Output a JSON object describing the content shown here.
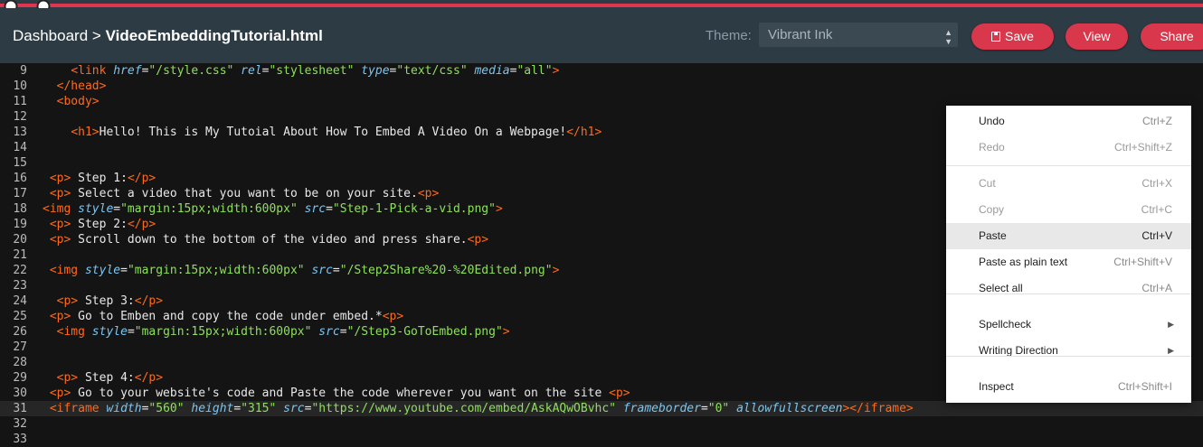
{
  "header": {
    "breadcrumb_root": "Dashboard",
    "breadcrumb_sep": ">",
    "file_name": "VideoEmbeddingTutorial.html",
    "theme_label": "Theme:",
    "theme_value": "Vibrant Ink",
    "save_label": "Save",
    "view_label": "View",
    "share_label": "Share"
  },
  "editor": {
    "lines": [
      {
        "n": "9",
        "tokens": [
          [
            "x",
            "    "
          ],
          [
            "t",
            "<link "
          ],
          [
            "a",
            "href"
          ],
          [
            "x",
            "="
          ],
          [
            "s",
            "\"/style.css\""
          ],
          [
            "x",
            " "
          ],
          [
            "a",
            "rel"
          ],
          [
            "x",
            "="
          ],
          [
            "s",
            "\"stylesheet\""
          ],
          [
            "x",
            " "
          ],
          [
            "a",
            "type"
          ],
          [
            "x",
            "="
          ],
          [
            "s",
            "\"text/css\""
          ],
          [
            "x",
            " "
          ],
          [
            "a",
            "media"
          ],
          [
            "x",
            "="
          ],
          [
            "s",
            "\"all\""
          ],
          [
            "t",
            ">"
          ]
        ]
      },
      {
        "n": "10",
        "tokens": [
          [
            "x",
            "  "
          ],
          [
            "t",
            "</head>"
          ]
        ]
      },
      {
        "n": "11",
        "tokens": [
          [
            "x",
            "  "
          ],
          [
            "t",
            "<body>"
          ]
        ]
      },
      {
        "n": "12",
        "tokens": []
      },
      {
        "n": "13",
        "tokens": [
          [
            "x",
            "    "
          ],
          [
            "t",
            "<h1>"
          ],
          [
            "x",
            "Hello! This is My Tutoial About How To Embed A Video On a Webpage!"
          ],
          [
            "t",
            "</h1>"
          ]
        ]
      },
      {
        "n": "14",
        "tokens": []
      },
      {
        "n": "15",
        "tokens": []
      },
      {
        "n": "16",
        "tokens": [
          [
            "x",
            " "
          ],
          [
            "t",
            "<p>"
          ],
          [
            "x",
            " Step 1:"
          ],
          [
            "t",
            "</p>"
          ]
        ]
      },
      {
        "n": "17",
        "tokens": [
          [
            "x",
            " "
          ],
          [
            "t",
            "<p>"
          ],
          [
            "x",
            " Select a video that you want to be on your site."
          ],
          [
            "t",
            "<p>"
          ]
        ]
      },
      {
        "n": "18",
        "tokens": [
          [
            "t",
            "<img "
          ],
          [
            "a",
            "style"
          ],
          [
            "x",
            "="
          ],
          [
            "s",
            "\"margin:15px;width:600px\""
          ],
          [
            "x",
            " "
          ],
          [
            "a",
            "src"
          ],
          [
            "x",
            "="
          ],
          [
            "s",
            "\"Step-1-Pick-a-vid.png\""
          ],
          [
            "t",
            ">"
          ]
        ]
      },
      {
        "n": "19",
        "tokens": [
          [
            "x",
            " "
          ],
          [
            "t",
            "<p>"
          ],
          [
            "x",
            " Step 2:"
          ],
          [
            "t",
            "</p>"
          ]
        ]
      },
      {
        "n": "20",
        "tokens": [
          [
            "x",
            " "
          ],
          [
            "t",
            "<p>"
          ],
          [
            "x",
            " Scroll down to the bottom of the video and press share."
          ],
          [
            "t",
            "<p>"
          ]
        ]
      },
      {
        "n": "21",
        "tokens": []
      },
      {
        "n": "22",
        "tokens": [
          [
            "x",
            " "
          ],
          [
            "t",
            "<img "
          ],
          [
            "a",
            "style"
          ],
          [
            "x",
            "="
          ],
          [
            "s",
            "\"margin:15px;width:600px\""
          ],
          [
            "x",
            " "
          ],
          [
            "a",
            "src"
          ],
          [
            "x",
            "="
          ],
          [
            "s",
            "\"/Step2Share%20-%20Edited.png\""
          ],
          [
            "t",
            ">"
          ]
        ]
      },
      {
        "n": "23",
        "tokens": []
      },
      {
        "n": "24",
        "tokens": [
          [
            "x",
            "  "
          ],
          [
            "t",
            "<p>"
          ],
          [
            "x",
            " Step 3:"
          ],
          [
            "t",
            "</p>"
          ]
        ]
      },
      {
        "n": "25",
        "tokens": [
          [
            "x",
            " "
          ],
          [
            "t",
            "<p>"
          ],
          [
            "x",
            " Go to Emben and copy the code under embed.*"
          ],
          [
            "t",
            "<p>"
          ]
        ]
      },
      {
        "n": "26",
        "tokens": [
          [
            "x",
            "  "
          ],
          [
            "t",
            "<img "
          ],
          [
            "a",
            "style"
          ],
          [
            "x",
            "="
          ],
          [
            "s",
            "\"margin:15px;width:600px\""
          ],
          [
            "x",
            " "
          ],
          [
            "a",
            "src"
          ],
          [
            "x",
            "="
          ],
          [
            "s",
            "\"/Step3-GoToEmbed.png\""
          ],
          [
            "t",
            ">"
          ]
        ]
      },
      {
        "n": "27",
        "tokens": []
      },
      {
        "n": "28",
        "tokens": []
      },
      {
        "n": "29",
        "tokens": [
          [
            "x",
            "  "
          ],
          [
            "t",
            "<p>"
          ],
          [
            "x",
            " Step 4:"
          ],
          [
            "t",
            "</p>"
          ]
        ]
      },
      {
        "n": "30",
        "tokens": [
          [
            "x",
            " "
          ],
          [
            "t",
            "<p>"
          ],
          [
            "x",
            " Go to your website's code and Paste the code wherever you want on the site "
          ],
          [
            "t",
            "<p>"
          ]
        ]
      },
      {
        "n": "31",
        "tokens": [
          [
            "x",
            " "
          ],
          [
            "t",
            "<iframe "
          ],
          [
            "a",
            "width"
          ],
          [
            "x",
            "="
          ],
          [
            "s",
            "\"560\""
          ],
          [
            "x",
            " "
          ],
          [
            "a",
            "height"
          ],
          [
            "x",
            "="
          ],
          [
            "s",
            "\"315\""
          ],
          [
            "x",
            " "
          ],
          [
            "a",
            "src"
          ],
          [
            "x",
            "="
          ],
          [
            "s",
            "\"https://www.youtube.com/embed/AskAQwOBvhc\""
          ],
          [
            "x",
            " "
          ],
          [
            "a",
            "frameborder"
          ],
          [
            "x",
            "="
          ],
          [
            "s",
            "\"0\""
          ],
          [
            "x",
            " "
          ],
          [
            "a",
            "allowfullscreen"
          ],
          [
            "t",
            "></iframe>"
          ]
        ]
      },
      {
        "n": "32",
        "tokens": []
      },
      {
        "n": "33",
        "tokens": []
      }
    ]
  },
  "context_menu": {
    "items": [
      {
        "label": "Undo",
        "shortcut": "Ctrl+Z",
        "disabled": false
      },
      {
        "label": "Redo",
        "shortcut": "Ctrl+Shift+Z",
        "disabled": true
      },
      {
        "label": "Cut",
        "shortcut": "Ctrl+X",
        "disabled": true
      },
      {
        "label": "Copy",
        "shortcut": "Ctrl+C",
        "disabled": true
      },
      {
        "label": "Paste",
        "shortcut": "Ctrl+V",
        "disabled": false
      },
      {
        "label": "Paste as plain text",
        "shortcut": "Ctrl+Shift+V",
        "disabled": false
      },
      {
        "label": "Select all",
        "shortcut": "Ctrl+A",
        "disabled": false
      },
      {
        "label": "Spellcheck",
        "shortcut": "",
        "disabled": false
      },
      {
        "label": "Writing Direction",
        "shortcut": "",
        "disabled": false
      },
      {
        "label": "Inspect",
        "shortcut": "Ctrl+Shift+I",
        "disabled": false
      }
    ]
  },
  "colors": {
    "header_bg": "#2d3b44",
    "accent_red": "#d9374b",
    "editor_bg": "#141414",
    "tag": "#ff6a1a",
    "attr": "#7ac6f2",
    "string": "#8ee05b"
  }
}
